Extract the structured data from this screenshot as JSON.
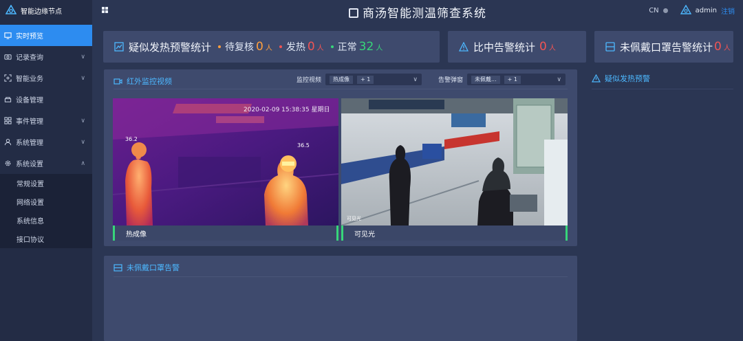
{
  "brand": {
    "name": "智能边缘节点"
  },
  "header": {
    "title": "商汤智能测温筛查系统",
    "lang": "CN",
    "user": "admin",
    "logout": "注销"
  },
  "sidebar": {
    "items": [
      {
        "label": "实时预览"
      },
      {
        "label": "记录查询"
      },
      {
        "label": "智能业务"
      },
      {
        "label": "设备管理"
      },
      {
        "label": "事件管理"
      },
      {
        "label": "系统管理"
      },
      {
        "label": "系统设置"
      }
    ],
    "sub_items": [
      {
        "label": "常规设置"
      },
      {
        "label": "网络设置"
      },
      {
        "label": "系统信息"
      },
      {
        "label": "接口协议"
      }
    ]
  },
  "stats": {
    "fever_stats": {
      "title": "疑似发热预警统计",
      "pending_label": "待复核",
      "pending_value": "0",
      "pending_unit": "人",
      "fever_label": "发热",
      "fever_value": "0",
      "fever_unit": "人",
      "normal_label": "正常",
      "normal_value": "32",
      "normal_unit": "人"
    },
    "compare_alarm": {
      "title": "比中告警统计",
      "value": "0",
      "unit": "人"
    },
    "mask_alarm": {
      "title": "未佩戴口罩告警统计",
      "value": "0",
      "unit": "人"
    }
  },
  "video_panel": {
    "title": "红外监控视频",
    "monitor_label": "监控视频",
    "monitor_tag": "热成像",
    "monitor_more": "+ 1",
    "alarm_label": "告警弹窗",
    "alarm_tag": "未佩戴...",
    "alarm_more": "+ 1",
    "thermal": {
      "caption": "热成像",
      "timestamp": "2020-02-09 15:38:35 星期日",
      "temp1": "36.2",
      "temp2": "36.5"
    },
    "visible": {
      "caption": "可见光",
      "corner": "可见光"
    }
  },
  "fever_alert_panel": {
    "title": "疑似发热预警"
  },
  "mask_panel": {
    "title": "未佩戴口罩告警"
  },
  "colors": {
    "accent": "#2d8cf0",
    "orange": "#ff9f3d",
    "red": "#f05454",
    "green": "#37d67a"
  }
}
